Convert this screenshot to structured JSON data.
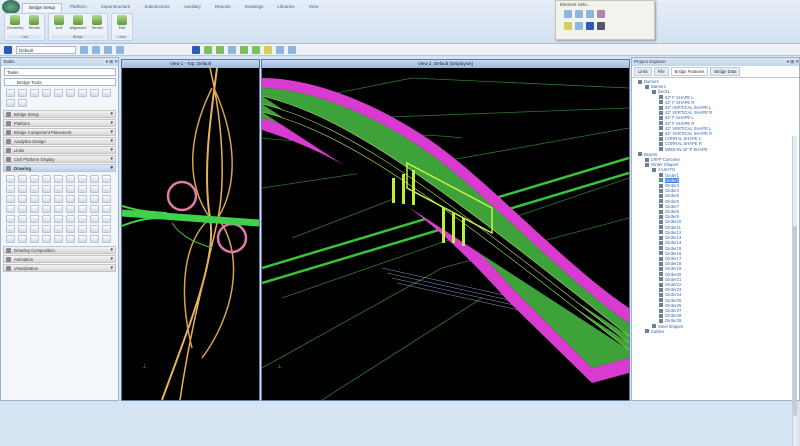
{
  "ribbon": {
    "tabs": [
      "Bridge Setup",
      "Platform",
      "Superstructure",
      "Substructure",
      "Auxiliary",
      "Reports",
      "Drawings",
      "Libraries",
      "View"
    ],
    "groups": [
      {
        "label": "Civil",
        "buttons": [
          "Geometry",
          "Terrain"
        ]
      },
      {
        "label": "Bridge",
        "buttons": [
          "Unit",
          "Alignment",
          "Terrain"
        ]
      },
      {
        "label": "Links",
        "buttons": [
          "Edit"
        ]
      }
    ]
  },
  "element_selection": {
    "title": "Element Sele..."
  },
  "toolbar": {
    "level": "Default"
  },
  "tasks": {
    "title": "Tasks",
    "dropdown": "Tasks",
    "current": "Bridge Tools",
    "sections": [
      "Bridge Setup",
      "Platform",
      "Bridge Component Placement",
      "Analytics Design",
      "Links",
      "Civil Platform Display"
    ],
    "open_section": "Drawing",
    "bottom_sections": [
      "Drawing Composition",
      "Animation",
      "Visualization"
    ]
  },
  "views": {
    "view1": "View 1 - Top, Default",
    "view2": "View 2, Default (Displayset)"
  },
  "explorer": {
    "title": "Project Explorer",
    "tabs": [
      "Links",
      "File",
      "Bridge Features",
      "Bridge Data"
    ],
    "tree": [
      {
        "d": 0,
        "t": "Barriers"
      },
      {
        "d": 1,
        "t": "Barriers"
      },
      {
        "d": 2,
        "t": "Deck1"
      },
      {
        "d": 3,
        "t": "42\" F SHAPE L"
      },
      {
        "d": 3,
        "t": "42\" F SHAPE R"
      },
      {
        "d": 3,
        "t": "42\" VERTICAL SHAPE L"
      },
      {
        "d": 3,
        "t": "42\" VERTICAL SHAPE R"
      },
      {
        "d": 3,
        "t": "42\" F SHAPE L"
      },
      {
        "d": 3,
        "t": "42\" F SHAPE R"
      },
      {
        "d": 3,
        "t": "42\" VERTICAL SHAPE L"
      },
      {
        "d": 3,
        "t": "42\" VERTICAL SHAPE R"
      },
      {
        "d": 3,
        "t": "CORRAL SHAPE L"
      },
      {
        "d": 3,
        "t": "CORRAL SHAPE R"
      },
      {
        "d": 3,
        "t": "MEDIAN 42\" F SHAPE"
      },
      {
        "d": 0,
        "t": "Beams"
      },
      {
        "d": 1,
        "t": "LRFP Concrete"
      },
      {
        "d": 1,
        "t": "Girder Shapes"
      },
      {
        "d": 2,
        "t": "AASHTO"
      },
      {
        "d": 3,
        "t": "Girder1"
      },
      {
        "d": 3,
        "t": "Girder2",
        "sel": true
      },
      {
        "d": 3,
        "t": "Girder3"
      },
      {
        "d": 3,
        "t": "Girder4"
      },
      {
        "d": 3,
        "t": "Girder5"
      },
      {
        "d": 3,
        "t": "Girder6"
      },
      {
        "d": 3,
        "t": "Girder7"
      },
      {
        "d": 3,
        "t": "Girder8"
      },
      {
        "d": 3,
        "t": "Girder9"
      },
      {
        "d": 3,
        "t": "Girder10"
      },
      {
        "d": 3,
        "t": "Girder11"
      },
      {
        "d": 3,
        "t": "Girder12"
      },
      {
        "d": 3,
        "t": "Girder13"
      },
      {
        "d": 3,
        "t": "Girder14"
      },
      {
        "d": 3,
        "t": "Girder15"
      },
      {
        "d": 3,
        "t": "Girder16"
      },
      {
        "d": 3,
        "t": "Girder17"
      },
      {
        "d": 3,
        "t": "Girder18"
      },
      {
        "d": 3,
        "t": "Girder19"
      },
      {
        "d": 3,
        "t": "Girder20"
      },
      {
        "d": 3,
        "t": "Girder21"
      },
      {
        "d": 3,
        "t": "Girder22"
      },
      {
        "d": 3,
        "t": "Girder23"
      },
      {
        "d": 3,
        "t": "Girder24"
      },
      {
        "d": 3,
        "t": "Girder25"
      },
      {
        "d": 3,
        "t": "Girder26"
      },
      {
        "d": 3,
        "t": "Girder27"
      },
      {
        "d": 3,
        "t": "Girder28"
      },
      {
        "d": 3,
        "t": "Girder29"
      },
      {
        "d": 2,
        "t": "Steel Shapes"
      },
      {
        "d": 1,
        "t": "Cables"
      }
    ]
  }
}
